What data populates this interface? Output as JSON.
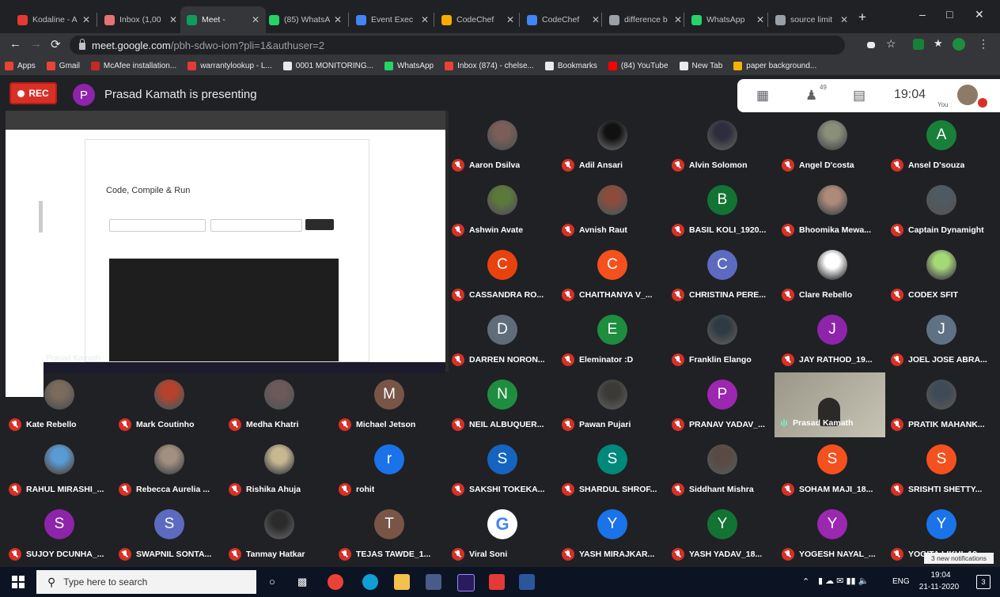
{
  "browser": {
    "tabs": [
      {
        "title": "Kodaline - A",
        "color": "#e53935",
        "active": false
      },
      {
        "title": "Inbox (1,00",
        "color": "#e57373",
        "active": false
      },
      {
        "title": "Meet - ",
        "color": "#0f9d58",
        "active": true
      },
      {
        "title": "(85) WhatsA",
        "color": "#25d366",
        "active": false
      },
      {
        "title": "Event Exec",
        "color": "#4285f4",
        "active": false
      },
      {
        "title": "CodeChef",
        "color": "#f9ab00",
        "active": false
      },
      {
        "title": "CodeChef",
        "color": "#4285f4",
        "active": false
      },
      {
        "title": "difference b",
        "color": "#9aa0a6",
        "active": false
      },
      {
        "title": "WhatsApp",
        "color": "#25d366",
        "active": false
      },
      {
        "title": "source limit",
        "color": "#9aa0a6",
        "active": false
      }
    ],
    "url_host": "meet.google.com",
    "url_path": "/pbh-sdwo-iom?pli=1&authuser=2",
    "bookmarks": [
      {
        "label": "Apps",
        "color": "#ea4335"
      },
      {
        "label": "Gmail",
        "color": "#ea4335"
      },
      {
        "label": "McAfee installation...",
        "color": "#c62828"
      },
      {
        "label": "warrantylookup - L...",
        "color": "#e53935"
      },
      {
        "label": "0001 MONITORING...",
        "color": "#e8eaed"
      },
      {
        "label": "WhatsApp",
        "color": "#25d366"
      },
      {
        "label": "Inbox (874) - chelse...",
        "color": "#ea4335"
      },
      {
        "label": "Bookmarks",
        "color": "#e8eaed"
      },
      {
        "label": "(84) YouTube",
        "color": "#ff0000"
      },
      {
        "label": "New Tab",
        "color": "#e8eaed"
      },
      {
        "label": "paper background...",
        "color": "#f4b400"
      }
    ]
  },
  "meet": {
    "rec_label": "REC",
    "presenter_initial": "P",
    "presenting_text": "Prasad Kamath is presenting",
    "participant_count": "49",
    "clock": "19:04",
    "you_label": "You",
    "shared_screen": {
      "heading": "Code, Compile & Run",
      "presenter_label": "Prasad Kamath"
    },
    "participants": [
      {
        "name": "Aaron Dsilva",
        "initial": "",
        "color": "#7b5e57",
        "photo": true
      },
      {
        "name": "Adil Ansari",
        "initial": "",
        "color": "#111111",
        "photo": true
      },
      {
        "name": "Alvin Solomon",
        "initial": "",
        "color": "#2d2d3d",
        "photo": true
      },
      {
        "name": "Angel D'costa",
        "initial": "",
        "color": "#8a8f7a",
        "photo": true
      },
      {
        "name": "Ansel D'souza",
        "initial": "A",
        "color": "#188038",
        "photo": false
      },
      {
        "name": "Ashwin Avate",
        "initial": "",
        "color": "#5b7a3a",
        "photo": true
      },
      {
        "name": "Avnish Raut",
        "initial": "",
        "color": "#8c4c3c",
        "photo": true
      },
      {
        "name": "BASIL KOLI_1920...",
        "initial": "B",
        "color": "#137333",
        "photo": false
      },
      {
        "name": "Bhoomika Mewa...",
        "initial": "",
        "color": "#b08a78",
        "photo": true
      },
      {
        "name": "Captain Dynamight",
        "initial": "",
        "color": "#4e5a62",
        "photo": true
      },
      {
        "name": "CASSANDRA RO...",
        "initial": "C",
        "color": "#e8430e",
        "photo": false
      },
      {
        "name": "CHAITHANYA V_...",
        "initial": "C",
        "color": "#f4511e",
        "photo": false
      },
      {
        "name": "CHRISTINA PERE...",
        "initial": "C",
        "color": "#5c6bc0",
        "photo": false
      },
      {
        "name": "Clare Rebello",
        "initial": "",
        "color": "#ffffff",
        "photo": true
      },
      {
        "name": "CODEX SFIT",
        "initial": "",
        "color": "#a3d977",
        "photo": true
      },
      {
        "name": "DARREN NORON...",
        "initial": "D",
        "color": "#5f6d7a",
        "photo": false
      },
      {
        "name": "Eleminator :D",
        "initial": "E",
        "color": "#1e8e3e",
        "photo": false
      },
      {
        "name": "Franklin Elango",
        "initial": "",
        "color": "#2f3b44",
        "photo": true
      },
      {
        "name": "JAY RATHOD_19...",
        "initial": "J",
        "color": "#8e24aa",
        "photo": false
      },
      {
        "name": "JOEL JOSE ABRA...",
        "initial": "J",
        "color": "#5f7285",
        "photo": false
      },
      {
        "name": "Kate Rebello",
        "initial": "",
        "color": "#7a6b5b",
        "photo": true
      },
      {
        "name": "Mark Coutinho",
        "initial": "",
        "color": "#b7422c",
        "photo": true
      },
      {
        "name": "Medha Khatri",
        "initial": "",
        "color": "#6b5a58",
        "photo": true
      },
      {
        "name": "Michael Jetson",
        "initial": "M",
        "color": "#795548",
        "photo": false
      },
      {
        "name": "NEIL ALBUQUER...",
        "initial": "N",
        "color": "#1e8e3e",
        "photo": false
      },
      {
        "name": "Pawan Pujari",
        "initial": "",
        "color": "#3b3a36",
        "photo": true
      },
      {
        "name": "PRANAV YADAV_...",
        "initial": "P",
        "color": "#9c27b0",
        "photo": false
      },
      {
        "name": "Prasad Kamath",
        "initial": "",
        "color": "",
        "photo": true,
        "video": true
      },
      {
        "name": "PRATIK MAHANK...",
        "initial": "",
        "color": "#3e4a57",
        "photo": true
      },
      {
        "name": "RAHUL MIRASHI_...",
        "initial": "",
        "color": "#5b9bd5",
        "photo": true
      },
      {
        "name": "Rebecca Aurelia ...",
        "initial": "",
        "color": "#a39080",
        "photo": true
      },
      {
        "name": "Rishika Ahuja",
        "initial": "",
        "color": "#c7b891",
        "photo": true
      },
      {
        "name": "rohit",
        "initial": "r",
        "color": "#1a73e8",
        "photo": false
      },
      {
        "name": "SAKSHI TOKEKA...",
        "initial": "S",
        "color": "#1565c0",
        "photo": false
      },
      {
        "name": "SHARDUL SHROF...",
        "initial": "S",
        "color": "#00897b",
        "photo": false
      },
      {
        "name": "Siddhant Mishra",
        "initial": "",
        "color": "#5a4a43",
        "photo": true
      },
      {
        "name": "SOHAM MAJI_18...",
        "initial": "S",
        "color": "#f4511e",
        "photo": false
      },
      {
        "name": "SRISHTI SHETTY...",
        "initial": "S",
        "color": "#f4511e",
        "photo": false
      },
      {
        "name": "SUJOY DCUNHA_...",
        "initial": "S",
        "color": "#8e24aa",
        "photo": false
      },
      {
        "name": "SWAPNIL SONTA...",
        "initial": "S",
        "color": "#5c6bc0",
        "photo": false
      },
      {
        "name": "Tanmay Hatkar",
        "initial": "",
        "color": "#2b2b2b",
        "photo": true
      },
      {
        "name": "TEJAS TAWDE_1...",
        "initial": "T",
        "color": "#795548",
        "photo": false
      },
      {
        "name": "Viral Soni",
        "initial": "G",
        "color": "#ffffff",
        "photo": false,
        "google": true
      },
      {
        "name": "YASH MIRAJKAR...",
        "initial": "Y",
        "color": "#1a73e8",
        "photo": false
      },
      {
        "name": "YASH YADAV_18...",
        "initial": "Y",
        "color": "#137333",
        "photo": false
      },
      {
        "name": "YOGESH NAYAL_...",
        "initial": "Y",
        "color": "#9c27b0",
        "photo": false
      },
      {
        "name": "YOGITA LIKHI_18...",
        "initial": "Y",
        "color": "#1a73e8",
        "photo": false
      }
    ],
    "notification": "3 new notifications"
  },
  "taskbar": {
    "search_placeholder": "Type here to search",
    "lang": "ENG",
    "time": "19:04",
    "date": "21-11-2020",
    "notif_count": "3"
  }
}
